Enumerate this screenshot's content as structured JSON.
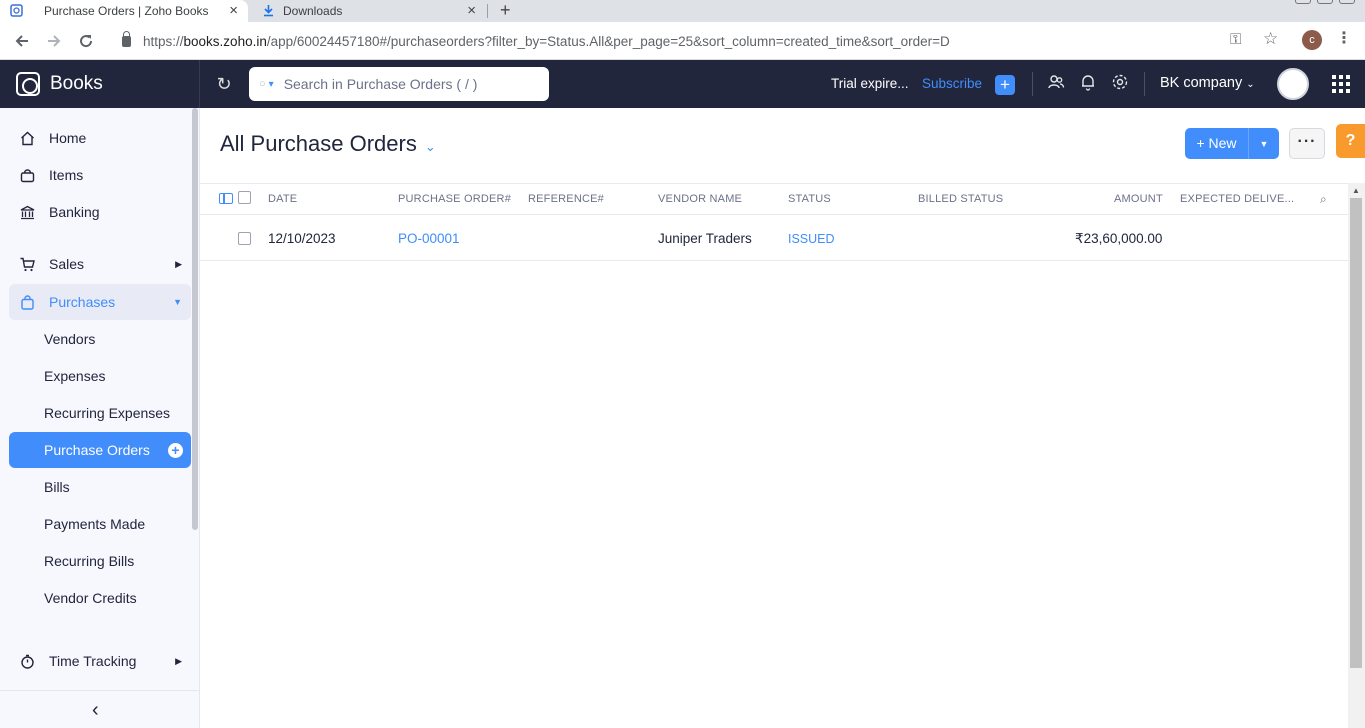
{
  "browser": {
    "tabs": [
      {
        "title": "Purchase Orders | Zoho Books",
        "active": true
      },
      {
        "title": "Downloads",
        "active": false
      }
    ],
    "url_host": "books.zoho.in",
    "url_path": "/app/60024457180#/purchaseorders?filter_by=Status.All&per_page=25&sort_column=created_time&sort_order=D",
    "url_scheme": "https://",
    "profile_initial": "c"
  },
  "header": {
    "app_name": "Books",
    "search_placeholder": "Search in Purchase Orders ( / )",
    "trial_text": "Trial expire...",
    "subscribe_label": "Subscribe",
    "org_name": "BK company"
  },
  "sidebar": {
    "items": [
      {
        "label": "Home"
      },
      {
        "label": "Items"
      },
      {
        "label": "Banking"
      },
      {
        "label": "Sales"
      },
      {
        "label": "Purchases"
      },
      {
        "label": "Vendors"
      },
      {
        "label": "Expenses"
      },
      {
        "label": "Recurring Expenses"
      },
      {
        "label": "Purchase Orders"
      },
      {
        "label": "Bills"
      },
      {
        "label": "Payments Made"
      },
      {
        "label": "Recurring Bills"
      },
      {
        "label": "Vendor Credits"
      },
      {
        "label": "Time Tracking"
      }
    ]
  },
  "main": {
    "title": "All Purchase Orders",
    "new_label": "New",
    "help_label": "?",
    "columns": [
      "DATE",
      "PURCHASE ORDER#",
      "REFERENCE#",
      "VENDOR NAME",
      "STATUS",
      "BILLED STATUS",
      "AMOUNT",
      "EXPECTED DELIVE..."
    ],
    "rows": [
      {
        "date": "12/10/2023",
        "po_number": "PO-00001",
        "reference": "",
        "vendor": "Juniper Traders",
        "status": "ISSUED",
        "billed_status": "",
        "amount": "₹23,60,000.00",
        "expected": ""
      }
    ]
  },
  "colors": {
    "accent": "#408dfb",
    "header_bg": "#21263c",
    "sidebar_bg": "#f7f7fe",
    "help": "#f99a2d"
  }
}
